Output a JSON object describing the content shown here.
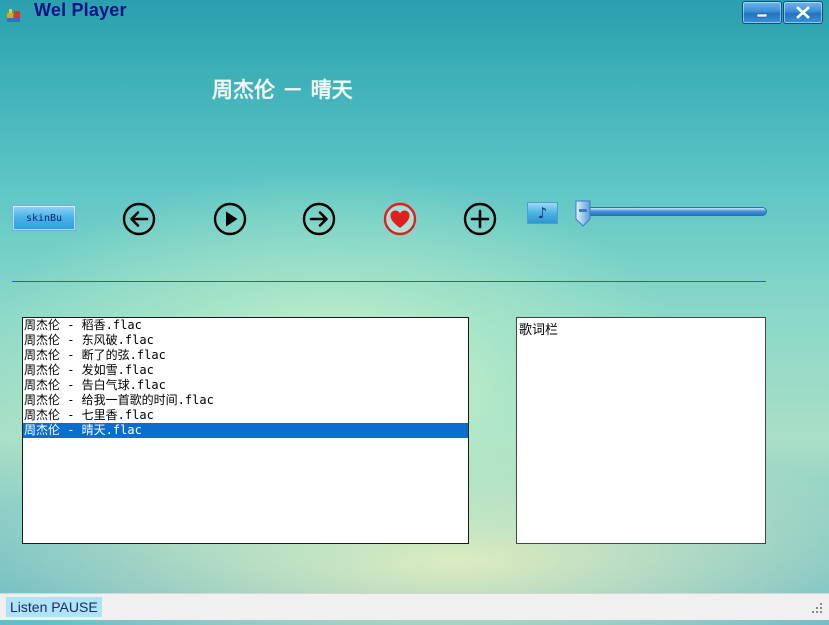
{
  "window": {
    "title": "Wel Player",
    "caption_buttons": {
      "minimize_icon": "minimize-icon",
      "close_icon": "close-icon"
    }
  },
  "now_playing": {
    "title": "周杰伦 － 晴天"
  },
  "controls": {
    "skin_button_label": "skinBu",
    "prev_icon": "arrow-left-circle-icon",
    "play_icon": "play-circle-icon",
    "next_icon": "arrow-right-circle-icon",
    "favorite_icon": "heart-icon",
    "add_icon": "plus-circle-icon",
    "music_icon": "music-note-icon",
    "volume_level": 0.03
  },
  "playlist": {
    "items": [
      "周杰伦 - 稻香.flac",
      "周杰伦 - 东风破.flac",
      "周杰伦 - 断了的弦.flac",
      "周杰伦 - 发如雪.flac",
      "周杰伦 - 告白气球.flac",
      "周杰伦 - 给我一首歌的时间.flac",
      "周杰伦 - 七里香.flac",
      "周杰伦 - 晴天.flac"
    ],
    "selected_index": 7
  },
  "lyrics": {
    "label": "歌词栏"
  },
  "status": {
    "text": "Listen  PAUSE"
  },
  "colors": {
    "title_text": "#10108a",
    "divider": "#2f55e6",
    "selection": "#0a6ed1",
    "favorite_red": "#e0201c",
    "status_highlight": "#aee4f6"
  }
}
